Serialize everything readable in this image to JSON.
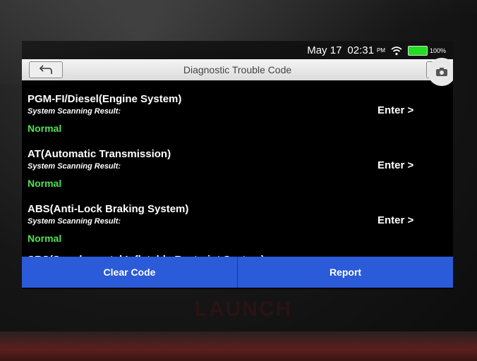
{
  "device": {
    "brand": "LAUNCH"
  },
  "status_bar": {
    "date": "May 17",
    "time": "02:31",
    "ampm": "PM",
    "battery": "100%",
    "wifi_icon": "wifi-icon",
    "battery_color": "#22dd22"
  },
  "header": {
    "title": "Diagnostic Trouble Code",
    "back_icon": "back-arrow-icon",
    "camera_icon": "camera-icon"
  },
  "systems": [
    {
      "name": "PGM-FI/Diesel(Engine System)",
      "result_label": "System Scanning Result:",
      "result": "Normal",
      "action": "Enter >"
    },
    {
      "name": "AT(Automatic Transmission)",
      "result_label": "System Scanning Result:",
      "result": "Normal",
      "action": "Enter >"
    },
    {
      "name": "ABS(Anti-Lock Braking System)",
      "result_label": "System Scanning Result:",
      "result": "Normal",
      "action": "Enter >"
    }
  ],
  "partial_item": "SRS(Supplemental Inflatable Restraint System)",
  "actions": {
    "clear_code": "Clear Code",
    "report": "Report",
    "accent": "#2b5bd8"
  },
  "colors": {
    "normal_status": "#4fe24f",
    "screen_bg": "#000000"
  }
}
